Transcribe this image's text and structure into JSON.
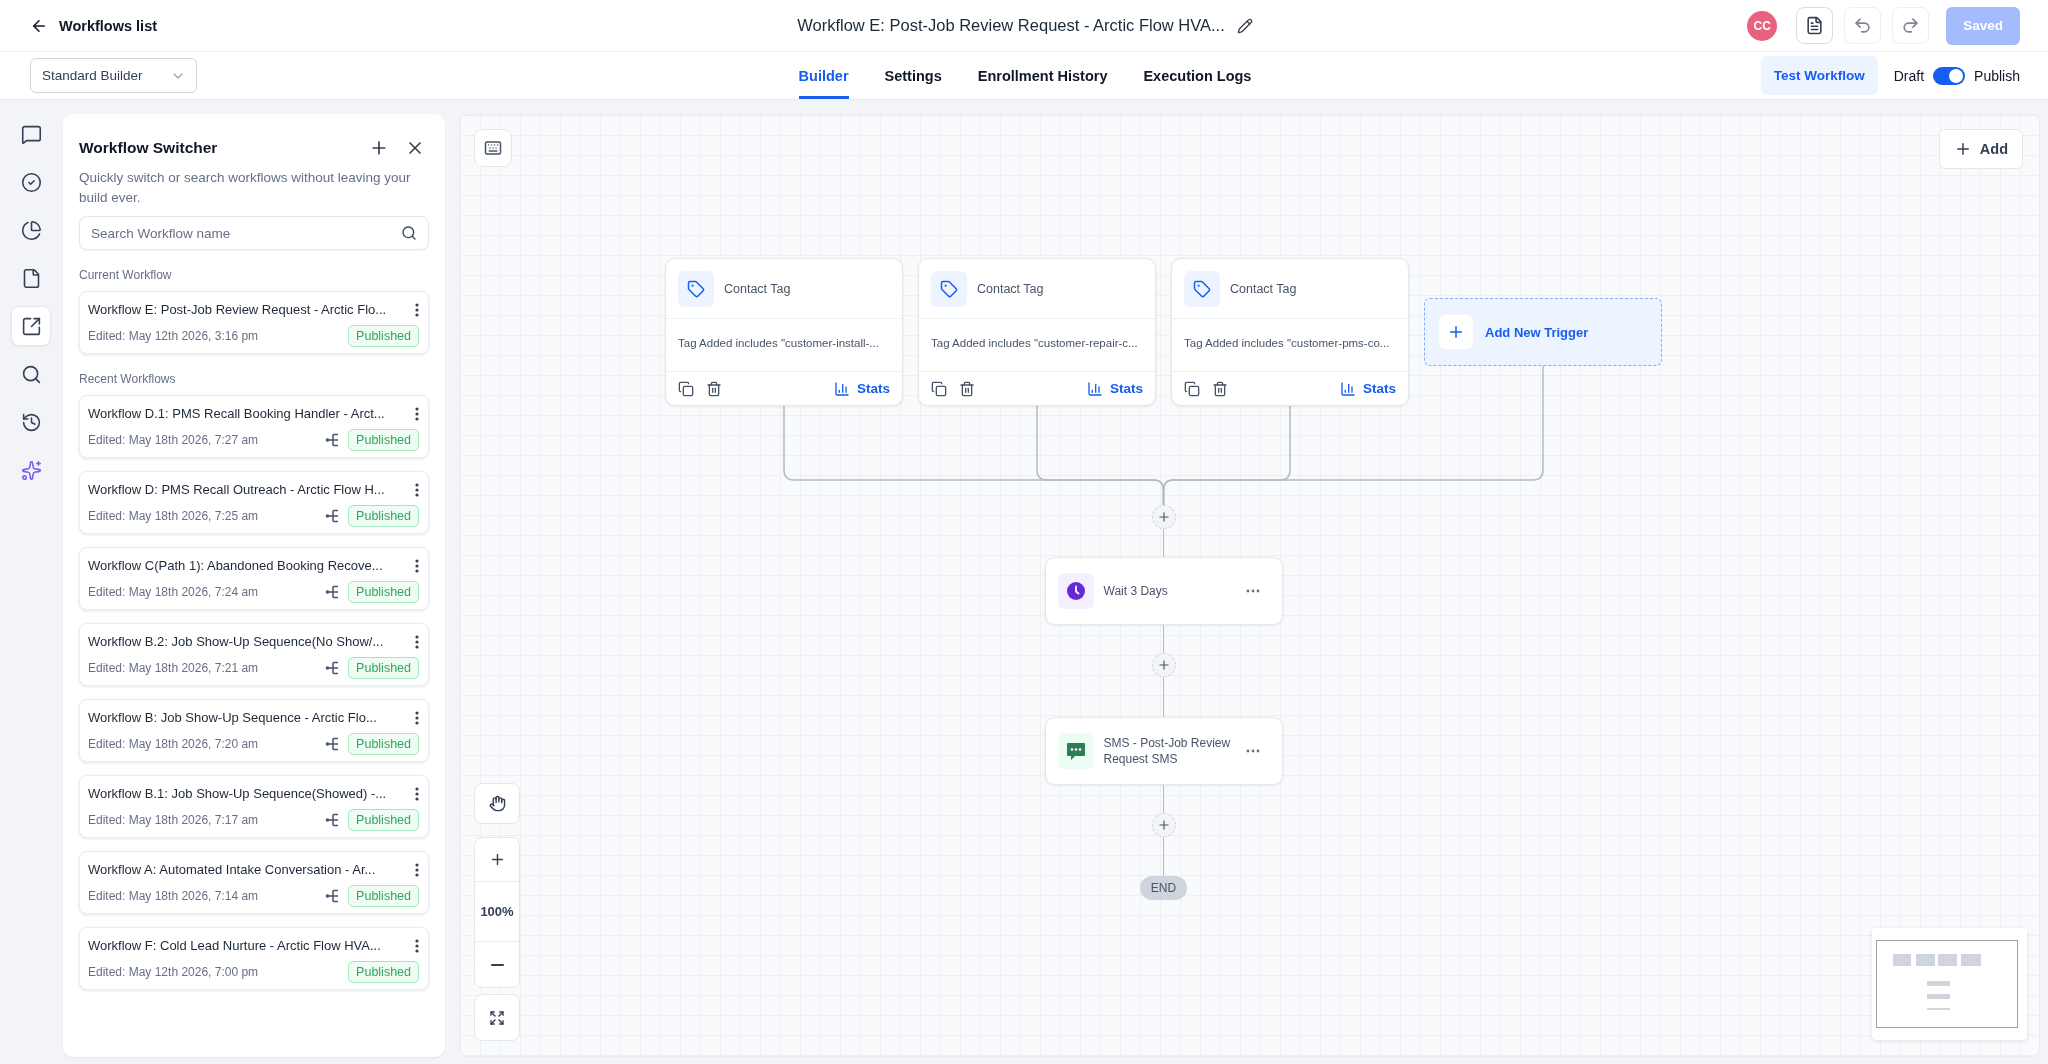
{
  "top_bar": {
    "back_link": "Workflows list",
    "workflow_title": "Workflow E: Post-Job Review Request - Arctic Flow HVA...",
    "avatar_initials": "CC",
    "save_button": {
      "label": "Saved",
      "disabled": true
    }
  },
  "toolbar": {
    "builder_select": {
      "value": "Standard Builder"
    },
    "tabs": [
      {
        "label": "Builder",
        "selected": true
      },
      {
        "label": "Settings",
        "selected": false
      },
      {
        "label": "Enrollment History",
        "selected": false
      },
      {
        "label": "Execution Logs",
        "selected": false
      }
    ],
    "test_button": "Test Workflow",
    "publish_toggle": {
      "off_label": "Draft",
      "on_label": "Publish",
      "on": true
    }
  },
  "side_rail": [
    {
      "selected": false
    },
    {
      "selected": false
    },
    {
      "selected": false
    },
    {
      "selected": false
    },
    {
      "selected": true
    },
    {
      "selected": false
    },
    {
      "selected": false
    },
    {
      "selected": false
    }
  ],
  "workflow_switcher": {
    "title": "Workflow Switcher",
    "description": "Quickly switch or search workflows without leaving your build ever.",
    "search": {
      "placeholder": "Search Workflow name"
    },
    "current_heading": "Current Workflow",
    "current": {
      "name": "Workflow E: Post-Job Review Request - Arctic Flo...",
      "edited": "Edited: May 12th 2026, 3:16 pm",
      "status": "Published",
      "has_branches": false
    },
    "recent_heading": "Recent Workflows",
    "recent": [
      {
        "name": "Workflow D.1: PMS Recall Booking Handler - Arct...",
        "edited": "Edited: May 18th 2026, 7:27 am",
        "status": "Published",
        "has_branches": true
      },
      {
        "name": "Workflow D: PMS Recall Outreach - Arctic Flow H...",
        "edited": "Edited: May 18th 2026, 7:25 am",
        "status": "Published",
        "has_branches": true
      },
      {
        "name": "Workflow C(Path 1): Abandoned Booking Recove...",
        "edited": "Edited: May 18th 2026, 7:24 am",
        "status": "Published",
        "has_branches": true
      },
      {
        "name": "Workflow B.2: Job Show-Up Sequence(No Show/...",
        "edited": "Edited: May 18th 2026, 7:21 am",
        "status": "Published",
        "has_branches": true
      },
      {
        "name": "Workflow B: Job Show-Up Sequence - Arctic Flo...",
        "edited": "Edited: May 18th 2026, 7:20 am",
        "status": "Published",
        "has_branches": true
      },
      {
        "name": "Workflow B.1: Job Show-Up Sequence(Showed) -...",
        "edited": "Edited: May 18th 2026, 7:17 am",
        "status": "Published",
        "has_branches": true
      },
      {
        "name": "Workflow A: Automated Intake Conversation - Ar...",
        "edited": "Edited: May 18th 2026, 7:14 am",
        "status": "Published",
        "has_branches": true
      },
      {
        "name": "Workflow F: Cold Lead Nurture - Arctic Flow HVA...",
        "edited": "Edited: May 12th 2026, 7:00 pm",
        "status": "Published",
        "has_branches": false
      }
    ]
  },
  "canvas": {
    "add_button": "Add",
    "triggers": [
      {
        "title": "Contact Tag",
        "condition": "Tag Added includes \"customer-install-...",
        "stats_label": "Stats"
      },
      {
        "title": "Contact Tag",
        "condition": "Tag Added includes \"customer-repair-c...",
        "stats_label": "Stats"
      },
      {
        "title": "Contact Tag",
        "condition": "Tag Added includes \"customer-pms-co...",
        "stats_label": "Stats"
      }
    ],
    "add_trigger_label": "Add New Trigger",
    "actions": [
      {
        "kind": "wait",
        "label": "Wait 3 Days"
      },
      {
        "kind": "sms",
        "label": "SMS - Post-Job Review Request SMS"
      }
    ],
    "end_label": "END",
    "zoom_level": "100%"
  }
}
